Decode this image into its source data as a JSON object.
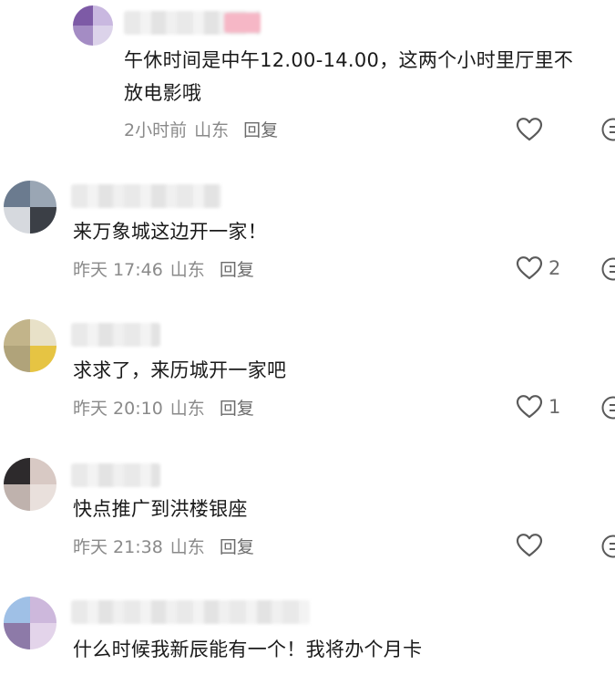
{
  "comments": [
    {
      "text_line1": "午休时间是中午12.00-14.00，这两个小时里厅里不",
      "text_line2": "放电影哦",
      "time": "2小时前",
      "location": "山东",
      "reply_label": "回复",
      "like_count": "",
      "avatar_colors": [
        "#7d5aa6",
        "#c9b8e0",
        "#dcd3ea",
        "#a48cc4"
      ]
    },
    {
      "text_line1": "来万象城这边开一家！",
      "time": "昨天 17:46",
      "location": "山东",
      "reply_label": "回复",
      "like_count": "2",
      "avatar_colors": [
        "#6b7b8f",
        "#9aa6b4",
        "#3b3f46",
        "#d6d9de"
      ]
    },
    {
      "text_line1": "求求了，来历城开一家吧",
      "time": "昨天 20:10",
      "location": "山东",
      "reply_label": "回复",
      "like_count": "1",
      "avatar_colors": [
        "#c2b48a",
        "#e6c443",
        "#e8e1c8",
        "#b0a37a"
      ]
    },
    {
      "text_line1": "快点推广到洪楼银座",
      "time": "昨天 21:38",
      "location": "山东",
      "reply_label": "回复",
      "like_count": "",
      "avatar_colors": [
        "#2d2a2c",
        "#d8c9c4",
        "#bfb2ad",
        "#e9e0dc"
      ]
    },
    {
      "text_line1": "什么时候我新辰能有一个！我将办个月卡",
      "avatar_colors": [
        "#9fc0e6",
        "#cdb8dc",
        "#8d7aa8",
        "#e3d4ea"
      ]
    }
  ],
  "icons": {
    "like": "heart-outline-icon",
    "more": "more-icon"
  },
  "colors": {
    "text": "#1a1a1a",
    "meta": "#8a8a8a"
  }
}
